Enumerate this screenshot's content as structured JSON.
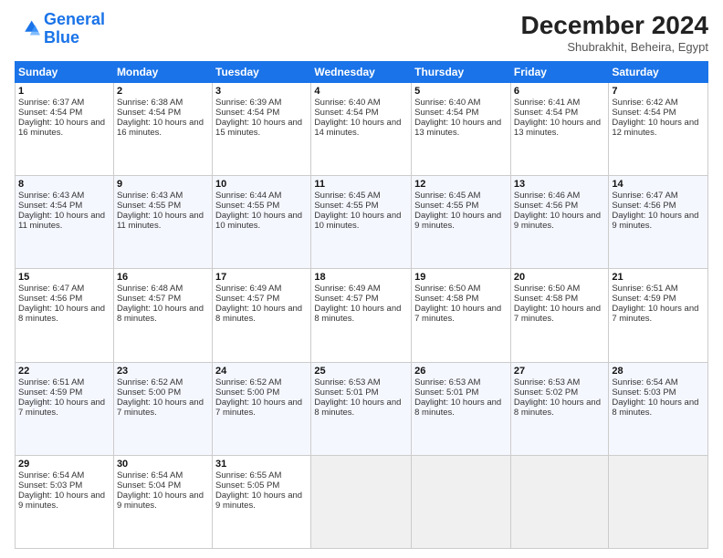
{
  "header": {
    "logo": {
      "line1": "General",
      "line2": "Blue"
    },
    "title": "December 2024",
    "location": "Shubrakhit, Beheira, Egypt"
  },
  "calendar": {
    "headers": [
      "Sunday",
      "Monday",
      "Tuesday",
      "Wednesday",
      "Thursday",
      "Friday",
      "Saturday"
    ],
    "weeks": [
      [
        null,
        null,
        {
          "day": "3",
          "sunrise": "6:39 AM",
          "sunset": "4:54 PM",
          "daylight": "10 hours and 15 minutes."
        },
        {
          "day": "4",
          "sunrise": "6:40 AM",
          "sunset": "4:54 PM",
          "daylight": "10 hours and 14 minutes."
        },
        {
          "day": "5",
          "sunrise": "6:40 AM",
          "sunset": "4:54 PM",
          "daylight": "10 hours and 13 minutes."
        },
        {
          "day": "6",
          "sunrise": "6:41 AM",
          "sunset": "4:54 PM",
          "daylight": "10 hours and 13 minutes."
        },
        {
          "day": "7",
          "sunrise": "6:42 AM",
          "sunset": "4:54 PM",
          "daylight": "10 hours and 12 minutes."
        }
      ],
      [
        {
          "day": "1",
          "sunrise": "6:37 AM",
          "sunset": "4:54 PM",
          "daylight": "10 hours and 16 minutes."
        },
        {
          "day": "2",
          "sunrise": "6:38 AM",
          "sunset": "4:54 PM",
          "daylight": "10 hours and 16 minutes."
        },
        {
          "day": "3",
          "sunrise": "6:39 AM",
          "sunset": "4:54 PM",
          "daylight": "10 hours and 15 minutes."
        },
        {
          "day": "4",
          "sunrise": "6:40 AM",
          "sunset": "4:54 PM",
          "daylight": "10 hours and 14 minutes."
        },
        {
          "day": "5",
          "sunrise": "6:40 AM",
          "sunset": "4:54 PM",
          "daylight": "10 hours and 13 minutes."
        },
        {
          "day": "6",
          "sunrise": "6:41 AM",
          "sunset": "4:54 PM",
          "daylight": "10 hours and 13 minutes."
        },
        {
          "day": "7",
          "sunrise": "6:42 AM",
          "sunset": "4:54 PM",
          "daylight": "10 hours and 12 minutes."
        }
      ],
      [
        {
          "day": "8",
          "sunrise": "6:43 AM",
          "sunset": "4:54 PM",
          "daylight": "10 hours and 11 minutes."
        },
        {
          "day": "9",
          "sunrise": "6:43 AM",
          "sunset": "4:55 PM",
          "daylight": "10 hours and 11 minutes."
        },
        {
          "day": "10",
          "sunrise": "6:44 AM",
          "sunset": "4:55 PM",
          "daylight": "10 hours and 10 minutes."
        },
        {
          "day": "11",
          "sunrise": "6:45 AM",
          "sunset": "4:55 PM",
          "daylight": "10 hours and 10 minutes."
        },
        {
          "day": "12",
          "sunrise": "6:45 AM",
          "sunset": "4:55 PM",
          "daylight": "10 hours and 9 minutes."
        },
        {
          "day": "13",
          "sunrise": "6:46 AM",
          "sunset": "4:56 PM",
          "daylight": "10 hours and 9 minutes."
        },
        {
          "day": "14",
          "sunrise": "6:47 AM",
          "sunset": "4:56 PM",
          "daylight": "10 hours and 9 minutes."
        }
      ],
      [
        {
          "day": "15",
          "sunrise": "6:47 AM",
          "sunset": "4:56 PM",
          "daylight": "10 hours and 8 minutes."
        },
        {
          "day": "16",
          "sunrise": "6:48 AM",
          "sunset": "4:57 PM",
          "daylight": "10 hours and 8 minutes."
        },
        {
          "day": "17",
          "sunrise": "6:49 AM",
          "sunset": "4:57 PM",
          "daylight": "10 hours and 8 minutes."
        },
        {
          "day": "18",
          "sunrise": "6:49 AM",
          "sunset": "4:57 PM",
          "daylight": "10 hours and 8 minutes."
        },
        {
          "day": "19",
          "sunrise": "6:50 AM",
          "sunset": "4:58 PM",
          "daylight": "10 hours and 7 minutes."
        },
        {
          "day": "20",
          "sunrise": "6:50 AM",
          "sunset": "4:58 PM",
          "daylight": "10 hours and 7 minutes."
        },
        {
          "day": "21",
          "sunrise": "6:51 AM",
          "sunset": "4:59 PM",
          "daylight": "10 hours and 7 minutes."
        }
      ],
      [
        {
          "day": "22",
          "sunrise": "6:51 AM",
          "sunset": "4:59 PM",
          "daylight": "10 hours and 7 minutes."
        },
        {
          "day": "23",
          "sunrise": "6:52 AM",
          "sunset": "5:00 PM",
          "daylight": "10 hours and 7 minutes."
        },
        {
          "day": "24",
          "sunrise": "6:52 AM",
          "sunset": "5:00 PM",
          "daylight": "10 hours and 7 minutes."
        },
        {
          "day": "25",
          "sunrise": "6:53 AM",
          "sunset": "5:01 PM",
          "daylight": "10 hours and 8 minutes."
        },
        {
          "day": "26",
          "sunrise": "6:53 AM",
          "sunset": "5:01 PM",
          "daylight": "10 hours and 8 minutes."
        },
        {
          "day": "27",
          "sunrise": "6:53 AM",
          "sunset": "5:02 PM",
          "daylight": "10 hours and 8 minutes."
        },
        {
          "day": "28",
          "sunrise": "6:54 AM",
          "sunset": "5:03 PM",
          "daylight": "10 hours and 8 minutes."
        }
      ],
      [
        {
          "day": "29",
          "sunrise": "6:54 AM",
          "sunset": "5:03 PM",
          "daylight": "10 hours and 9 minutes."
        },
        {
          "day": "30",
          "sunrise": "6:54 AM",
          "sunset": "5:04 PM",
          "daylight": "10 hours and 9 minutes."
        },
        {
          "day": "31",
          "sunrise": "6:55 AM",
          "sunset": "5:05 PM",
          "daylight": "10 hours and 9 minutes."
        },
        null,
        null,
        null,
        null
      ]
    ]
  }
}
